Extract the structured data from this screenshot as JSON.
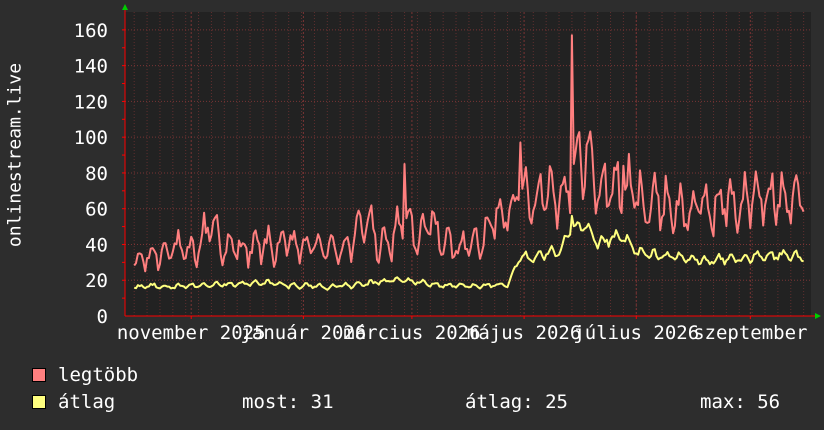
{
  "chart_data": {
    "type": "line",
    "ylabel": "onlinestream.live",
    "ylim": [
      0,
      170
    ],
    "yticks": [
      0,
      20,
      40,
      60,
      80,
      100,
      120,
      140,
      160
    ],
    "x_months": [
      "2025-11",
      "2026-01",
      "2026-03",
      "2026-05",
      "2026-07",
      "2026-09"
    ],
    "xtick_labels": [
      "november 2025",
      "január 2026",
      "március 2026",
      "május 2026",
      "július 2026",
      "szeptember"
    ],
    "grid": true,
    "series": [
      {
        "name": "legtöbb",
        "color": "#ff7f7f",
        "weekly_points": [
          [
            "2025-10-01",
            29
          ],
          [
            "2025-10-08",
            33
          ],
          [
            "2025-10-15",
            35
          ],
          [
            "2025-10-22",
            40
          ],
          [
            "2025-10-29",
            34
          ],
          [
            "2025-11-05",
            38
          ],
          [
            "2025-11-12",
            55
          ],
          [
            "2025-11-19",
            36
          ],
          [
            "2025-11-26",
            39
          ],
          [
            "2025-12-03",
            37
          ],
          [
            "2025-12-10",
            40
          ],
          [
            "2025-12-17",
            38
          ],
          [
            "2025-12-24",
            41
          ],
          [
            "2025-12-31",
            38
          ],
          [
            "2026-01-07",
            40
          ],
          [
            "2026-01-14",
            37
          ],
          [
            "2026-01-21",
            39
          ],
          [
            "2026-01-28",
            40
          ],
          [
            "2026-02-04",
            58
          ],
          [
            "2026-02-11",
            38
          ],
          [
            "2026-02-18",
            41
          ],
          [
            "2026-02-25",
            60
          ],
          [
            "2026-03-04",
            39
          ],
          [
            "2026-03-11",
            55
          ],
          [
            "2026-03-18",
            40
          ],
          [
            "2026-03-25",
            38
          ],
          [
            "2026-04-01",
            42
          ],
          [
            "2026-04-08",
            40
          ],
          [
            "2026-04-15",
            56
          ],
          [
            "2026-04-22",
            60
          ],
          [
            "2026-04-29",
            70
          ],
          [
            "2026-05-06",
            66
          ],
          [
            "2026-05-13",
            72
          ],
          [
            "2026-05-20",
            68
          ],
          [
            "2026-05-27",
            75
          ],
          [
            "2026-06-03",
            95
          ],
          [
            "2026-06-10",
            70
          ],
          [
            "2026-06-17",
            74
          ],
          [
            "2026-06-24",
            72
          ],
          [
            "2026-07-01",
            68
          ],
          [
            "2026-07-08",
            62
          ],
          [
            "2026-07-15",
            65
          ],
          [
            "2026-07-22",
            60
          ],
          [
            "2026-07-29",
            58
          ],
          [
            "2026-08-05",
            62
          ],
          [
            "2026-08-12",
            60
          ],
          [
            "2026-08-19",
            64
          ],
          [
            "2026-08-26",
            62
          ],
          [
            "2026-09-02",
            66
          ],
          [
            "2026-09-09",
            65
          ],
          [
            "2026-09-16",
            68
          ],
          [
            "2026-09-23",
            70
          ],
          [
            "2026-09-30",
            66
          ]
        ],
        "spikes": [
          [
            "2026-02-25",
            85
          ],
          [
            "2026-04-29",
            97
          ],
          [
            "2026-05-27",
            157
          ],
          [
            "2026-06-24",
            84
          ]
        ]
      },
      {
        "name": "átlag",
        "color": "#ffff7f",
        "weekly_points": [
          [
            "2025-10-01",
            16
          ],
          [
            "2025-10-08",
            17
          ],
          [
            "2025-10-15",
            17
          ],
          [
            "2025-10-22",
            16
          ],
          [
            "2025-10-29",
            17
          ],
          [
            "2025-11-05",
            17
          ],
          [
            "2025-11-12",
            18
          ],
          [
            "2025-11-19",
            18
          ],
          [
            "2025-11-26",
            18
          ],
          [
            "2025-12-03",
            18
          ],
          [
            "2025-12-10",
            19
          ],
          [
            "2025-12-17",
            18
          ],
          [
            "2025-12-24",
            17
          ],
          [
            "2025-12-31",
            17
          ],
          [
            "2026-01-07",
            17
          ],
          [
            "2026-01-14",
            16
          ],
          [
            "2026-01-21",
            17
          ],
          [
            "2026-01-28",
            17
          ],
          [
            "2026-02-04",
            18
          ],
          [
            "2026-02-11",
            19
          ],
          [
            "2026-02-18",
            20
          ],
          [
            "2026-02-25",
            20
          ],
          [
            "2026-03-04",
            19
          ],
          [
            "2026-03-11",
            18
          ],
          [
            "2026-03-18",
            17
          ],
          [
            "2026-03-25",
            17
          ],
          [
            "2026-04-01",
            17
          ],
          [
            "2026-04-08",
            17
          ],
          [
            "2026-04-15",
            17
          ],
          [
            "2026-04-22",
            17
          ],
          [
            "2026-04-29",
            33
          ],
          [
            "2026-05-06",
            33
          ],
          [
            "2026-05-13",
            35
          ],
          [
            "2026-05-20",
            36
          ],
          [
            "2026-05-27",
            48
          ],
          [
            "2026-06-03",
            50
          ],
          [
            "2026-06-10",
            40
          ],
          [
            "2026-06-17",
            43
          ],
          [
            "2026-06-24",
            44
          ],
          [
            "2026-07-01",
            36
          ],
          [
            "2026-07-08",
            34
          ],
          [
            "2026-07-15",
            34
          ],
          [
            "2026-07-22",
            33
          ],
          [
            "2026-07-29",
            32
          ],
          [
            "2026-08-05",
            31
          ],
          [
            "2026-08-12",
            31
          ],
          [
            "2026-08-19",
            32
          ],
          [
            "2026-08-26",
            32
          ],
          [
            "2026-09-02",
            33
          ],
          [
            "2026-09-09",
            33
          ],
          [
            "2026-09-16",
            34
          ],
          [
            "2026-09-23",
            34
          ],
          [
            "2026-09-30",
            32
          ]
        ],
        "spikes": [
          [
            "2026-05-27",
            56
          ]
        ]
      }
    ]
  },
  "legend": {
    "max_label": "legtöbb",
    "avg_label": "átlag",
    "max_color": "#ff7f7f",
    "avg_color": "#ffff7f"
  },
  "stats": {
    "now": "most: 31",
    "avg": "átlag: 25",
    "max": "max: 56"
  },
  "colors": {
    "background": "#2d2d2d",
    "plot_background": "#222222",
    "grid": "#7a3434",
    "axis": "#ff0000",
    "arrow": "#00cc00",
    "text": "#ffffff"
  }
}
